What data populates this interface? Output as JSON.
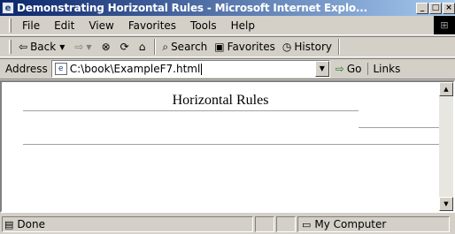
{
  "window": {
    "title": "Demonstrating Horizontal Rules - Microsoft Internet Explo...",
    "controls": [
      "_",
      "□",
      "×"
    ]
  },
  "menu": {
    "items": [
      {
        "label": "File"
      },
      {
        "label": "Edit"
      },
      {
        "label": "View"
      },
      {
        "label": "Favorites"
      },
      {
        "label": "Tools"
      },
      {
        "label": "Help"
      }
    ]
  },
  "toolbar": {
    "back_label": "Back",
    "search_label": "Search",
    "favorites_label": "Favorites",
    "history_label": "History"
  },
  "address": {
    "label": "Address",
    "value": "C:\\book\\ExampleF7.html",
    "go_label": "Go",
    "links_label": "Links"
  },
  "page": {
    "heading": "Horizontal Rules"
  },
  "status": {
    "text": "Done",
    "zone": "My Computer"
  }
}
